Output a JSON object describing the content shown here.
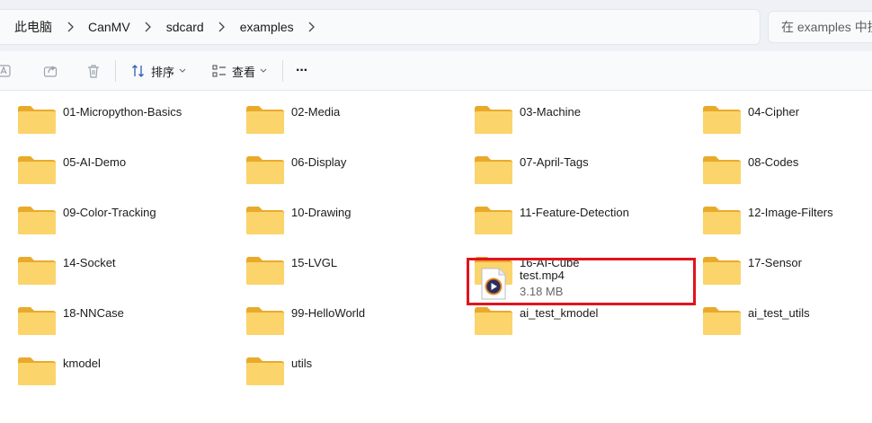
{
  "breadcrumb": [
    "此电脑",
    "CanMV",
    "sdcard",
    "examples"
  ],
  "search": {
    "placeholder": "在 examples 中搜"
  },
  "toolbar": {
    "sort_label": "排序",
    "view_label": "查看",
    "more_label": "···"
  },
  "folders": [
    "01-Micropython-Basics",
    "02-Media",
    "03-Machine",
    "04-Cipher",
    "05-AI-Demo",
    "06-Display",
    "07-April-Tags",
    "08-Codes",
    "09-Color-Tracking",
    "10-Drawing",
    "11-Feature-Detection",
    "12-Image-Filters",
    "14-Socket",
    "15-LVGL",
    "16-AI-Cube",
    "17-Sensor",
    "18-NNCase",
    "99-HelloWorld",
    "ai_test_kmodel",
    "ai_test_utils",
    "kmodel",
    "utils"
  ],
  "file": {
    "name": "test.mp4",
    "size": "3.18 MB",
    "icon": "media-player-icon"
  },
  "colors": {
    "highlight_border": "#e0141e",
    "folder": "#f7c948"
  }
}
